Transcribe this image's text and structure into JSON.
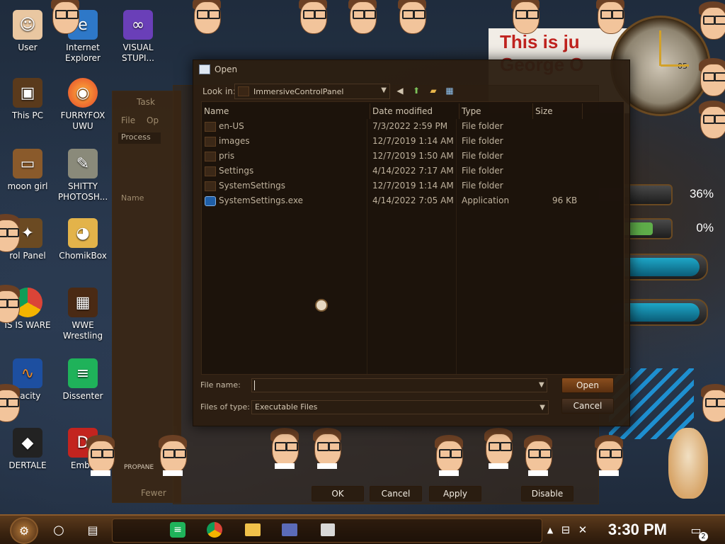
{
  "desktop_icons": [
    {
      "label": "User"
    },
    {
      "label": "Internet Explorer"
    },
    {
      "label": "VISUAL STUPI..."
    },
    {
      "label": "This PC"
    },
    {
      "label": "FURRYFOX UWU"
    },
    {
      "label": "moon girl"
    },
    {
      "label": "SHITTY PHOTOSH..."
    },
    {
      "label": "rol Panel"
    },
    {
      "label": "ChomikBox"
    },
    {
      "label": "IS IS WARE"
    },
    {
      "label": "WWE Wrestling"
    },
    {
      "label": "dacity"
    },
    {
      "label": "Dissenter"
    },
    {
      "label": "DERTALE"
    },
    {
      "label": "Emba"
    }
  ],
  "gauges": [
    {
      "value_label": "36%",
      "percent": 36,
      "color": "#bdbdbd"
    },
    {
      "value_label": "0%",
      "percent": 0,
      "color": "#5fae4a"
    }
  ],
  "background": {
    "poster_text": "This is ju",
    "poster_text2": "George O",
    "clock_number": "05"
  },
  "dialog": {
    "title": "Open",
    "look_in_label": "Look in:",
    "look_in_value": "ImmersiveControlPanel",
    "columns": {
      "name": "Name",
      "date": "Date modified",
      "type": "Type",
      "size": "Size"
    },
    "files": [
      {
        "name": "en-US",
        "date": "7/3/2022 2:59 PM",
        "type": "File folder",
        "size": "",
        "kind": "folder"
      },
      {
        "name": "images",
        "date": "12/7/2019 1:14 AM",
        "type": "File folder",
        "size": "",
        "kind": "folder"
      },
      {
        "name": "pris",
        "date": "12/7/2019 1:50 AM",
        "type": "File folder",
        "size": "",
        "kind": "folder"
      },
      {
        "name": "Settings",
        "date": "4/14/2022 7:17 AM",
        "type": "File folder",
        "size": "",
        "kind": "folder"
      },
      {
        "name": "SystemSettings",
        "date": "12/7/2019 1:14 AM",
        "type": "File folder",
        "size": "",
        "kind": "folder"
      },
      {
        "name": "SystemSettings.exe",
        "date": "4/14/2022 7:05 AM",
        "type": "Application",
        "size": "96 KB",
        "kind": "exe"
      }
    ],
    "file_name_label": "File name:",
    "file_name_value": "",
    "files_of_type_label": "Files of type:",
    "files_of_type_value": "Executable Files",
    "open_button": "Open",
    "cancel_button": "Cancel"
  },
  "background_windows": {
    "task_title": "Task",
    "task_menu_file": "File",
    "task_menu_op": "Op",
    "task_tab": "Process",
    "task_col": "Name",
    "task_fewer": "Fewer",
    "ok_button": "OK",
    "cancel_button": "Cancel",
    "apply_button": "Apply",
    "disable_button": "Disable",
    "properties_text": "PROPANE"
  },
  "taskbar": {
    "time": "3:30 PM",
    "notification_count": "2"
  }
}
